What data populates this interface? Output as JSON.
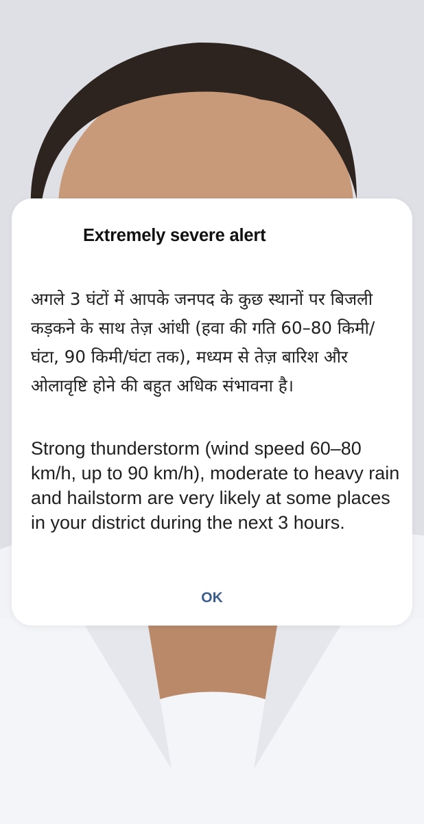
{
  "alert": {
    "title": "Extremely severe alert",
    "message_hindi": "अगले 3 घंटों में आपके जनपद के कुछ स्थानों पर बिजली कड़कने के साथ तेज़ आंधी (हवा की गति 60–80 किमी/घंटा,  90 किमी/घंटा तक), मध्यम से तेज़ बारिश और ओलावृष्टि होने की बहुत अधिक संभावना है।",
    "message_english": "Strong thunderstorm (wind speed 60–80 km/h, up to 90 km/h), moderate to heavy rain and hailstorm are very likely at some places in your district during the next 3 hours.",
    "ok_label": "OK"
  },
  "colors": {
    "accent": "#3b5e8c",
    "dialog_bg": "#ffffff",
    "text": "#1f1f1f"
  }
}
